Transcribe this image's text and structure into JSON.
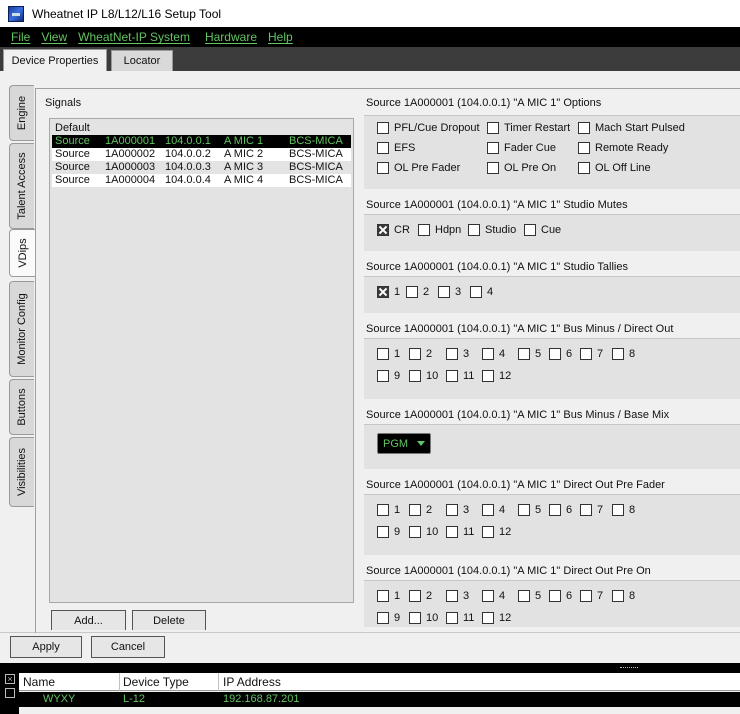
{
  "window": {
    "title": "Wheatnet IP L8/L12/L16 Setup Tool"
  },
  "menu": [
    "File",
    "View",
    "WheatNet-IP System",
    "Hardware",
    "Help"
  ],
  "top_tabs": [
    "Device Properties",
    "Locator"
  ],
  "side_tabs": [
    "Engine",
    "Talent Access",
    "VDips",
    "Monitor Config",
    "Buttons",
    "Visibilities"
  ],
  "signals": {
    "label": "Signals",
    "header": "Default",
    "rows": [
      {
        "type": "Source",
        "id": "1A000001",
        "ip": "104.0.0.1",
        "name": "A MIC 1",
        "device": "BCS-MICA"
      },
      {
        "type": "Source",
        "id": "1A000002",
        "ip": "104.0.0.2",
        "name": "A MIC 2",
        "device": "BCS-MICA"
      },
      {
        "type": "Source",
        "id": "1A000003",
        "ip": "104.0.0.3",
        "name": "A MIC 3",
        "device": "BCS-MICA"
      },
      {
        "type": "Source",
        "id": "1A000004",
        "ip": "104.0.0.4",
        "name": "A MIC 4",
        "device": "BCS-MICA"
      }
    ],
    "add_label": "Add...",
    "delete_label": "Delete"
  },
  "sections": {
    "options": {
      "title": "Source 1A000001 (104.0.0.1) \"A MIC 1\" Options",
      "items": [
        "PFL/Cue Dropout",
        "Timer Restart",
        "Mach Start Pulsed",
        "EFS",
        "Fader Cue",
        "Remote Ready",
        "OL Pre Fader",
        "OL Pre On",
        "OL Off Line"
      ]
    },
    "mutes": {
      "title": "Source 1A000001 (104.0.0.1) \"A MIC 1\" Studio Mutes",
      "items": [
        "CR",
        "Hdpn",
        "Studio",
        "Cue"
      ]
    },
    "tallies": {
      "title": "Source 1A000001 (104.0.0.1) \"A MIC 1\" Studio Tallies",
      "items": [
        "1",
        "2",
        "3",
        "4"
      ]
    },
    "bus_direct": {
      "title": "Source 1A000001 (104.0.0.1) \"A MIC 1\" Bus Minus / Direct Out",
      "items": [
        "1",
        "2",
        "3",
        "4",
        "5",
        "6",
        "7",
        "8",
        "9",
        "10",
        "11",
        "12"
      ]
    },
    "bus_base": {
      "title": "Source 1A000001 (104.0.0.1) \"A MIC 1\" Bus Minus / Base Mix",
      "value": "PGM"
    },
    "direct_prefader": {
      "title": "Source 1A000001 (104.0.0.1) \"A MIC 1\" Direct Out Pre Fader",
      "items": [
        "1",
        "2",
        "3",
        "4",
        "5",
        "6",
        "7",
        "8",
        "9",
        "10",
        "11",
        "12"
      ]
    },
    "direct_preon": {
      "title": "Source 1A000001 (104.0.0.1) \"A MIC 1\" Direct Out Pre On",
      "items": [
        "1",
        "2",
        "3",
        "4",
        "5",
        "6",
        "7",
        "8",
        "9",
        "10",
        "11",
        "12"
      ]
    }
  },
  "buttons": {
    "apply": "Apply",
    "cancel": "Cancel"
  },
  "devices": {
    "columns": [
      "Name",
      "Device Type",
      "IP Address"
    ],
    "row": {
      "name": "WYXY",
      "type": "L-12",
      "ip": "192.168.87.201"
    }
  },
  "colors": {
    "accent_green": "#62c462",
    "menubar_bg": "#000000"
  },
  "icons": [
    "app-icon",
    "close-icon",
    "float-icon",
    "dropdown-arrow-icon"
  ]
}
